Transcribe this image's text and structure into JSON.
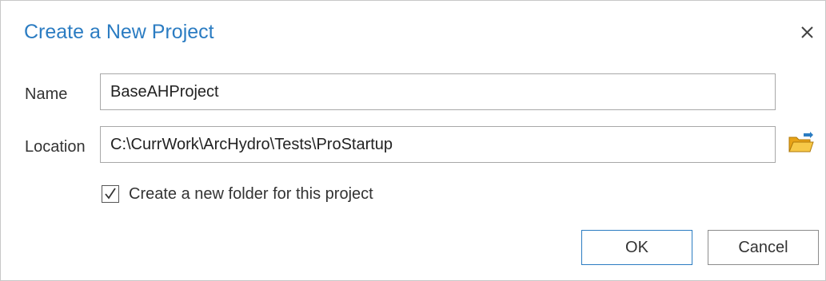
{
  "dialog": {
    "title": "Create a New Project"
  },
  "form": {
    "name_label": "Name",
    "name_value": "BaseAHProject",
    "location_label": "Location",
    "location_value": "C:\\CurrWork\\ArcHydro\\Tests\\ProStartup",
    "create_folder_label": "Create a new folder for this project",
    "create_folder_checked": true
  },
  "buttons": {
    "ok_label": "OK",
    "cancel_label": "Cancel"
  },
  "icons": {
    "close": "close-icon",
    "browse": "folder-open-icon",
    "check": "checkmark-icon"
  },
  "colors": {
    "accent": "#2b7cc2",
    "folder": "#f0b429"
  }
}
